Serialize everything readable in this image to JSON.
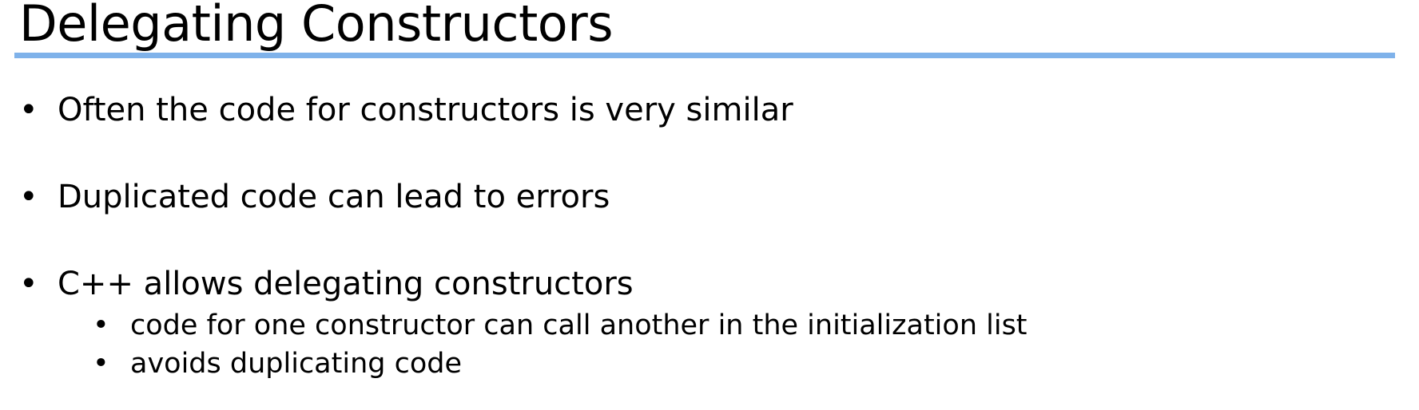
{
  "slide": {
    "title": "Delegating Constructors",
    "accent_color": "#7fb2ea",
    "bullet_glyph": "•",
    "bullets": [
      {
        "text": "Often the code for constructors is very similar"
      },
      {
        "text": "Duplicated code can lead to errors"
      },
      {
        "text": "C++ allows delegating constructors",
        "sub": [
          "code for one constructor can call another in the initialization list",
          "avoids duplicating code"
        ]
      }
    ]
  }
}
